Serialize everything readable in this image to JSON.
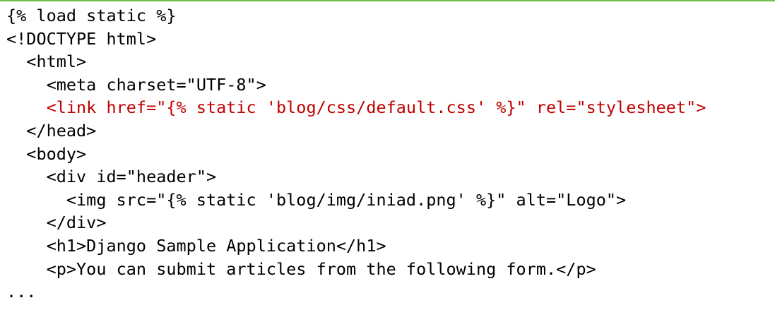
{
  "colors": {
    "text": "#000000",
    "highlight": "#c00000",
    "top_border": "#6cc04a",
    "background": "#ffffff"
  },
  "code": {
    "lines": [
      {
        "text": "{% load static %}",
        "highlight": false
      },
      {
        "text": "<!DOCTYPE html>",
        "highlight": false
      },
      {
        "text": "  <html>",
        "highlight": false
      },
      {
        "text": "    <meta charset=\"UTF-8\">",
        "highlight": false
      },
      {
        "text": "    <link href=\"{% static 'blog/css/default.css' %}\" rel=\"stylesheet\">",
        "highlight": true
      },
      {
        "text": "  </head>",
        "highlight": false
      },
      {
        "text": "  <body>",
        "highlight": false
      },
      {
        "text": "    <div id=\"header\">",
        "highlight": false
      },
      {
        "text": "      <img src=\"{% static 'blog/img/iniad.png' %}\" alt=\"Logo\">",
        "highlight": false
      },
      {
        "text": "    </div>",
        "highlight": false
      },
      {
        "text": "    <h1>Django Sample Application</h1>",
        "highlight": false
      },
      {
        "text": "    <p>You can submit articles from the following form.</p>",
        "highlight": false
      },
      {
        "text": "...",
        "highlight": false
      }
    ]
  }
}
